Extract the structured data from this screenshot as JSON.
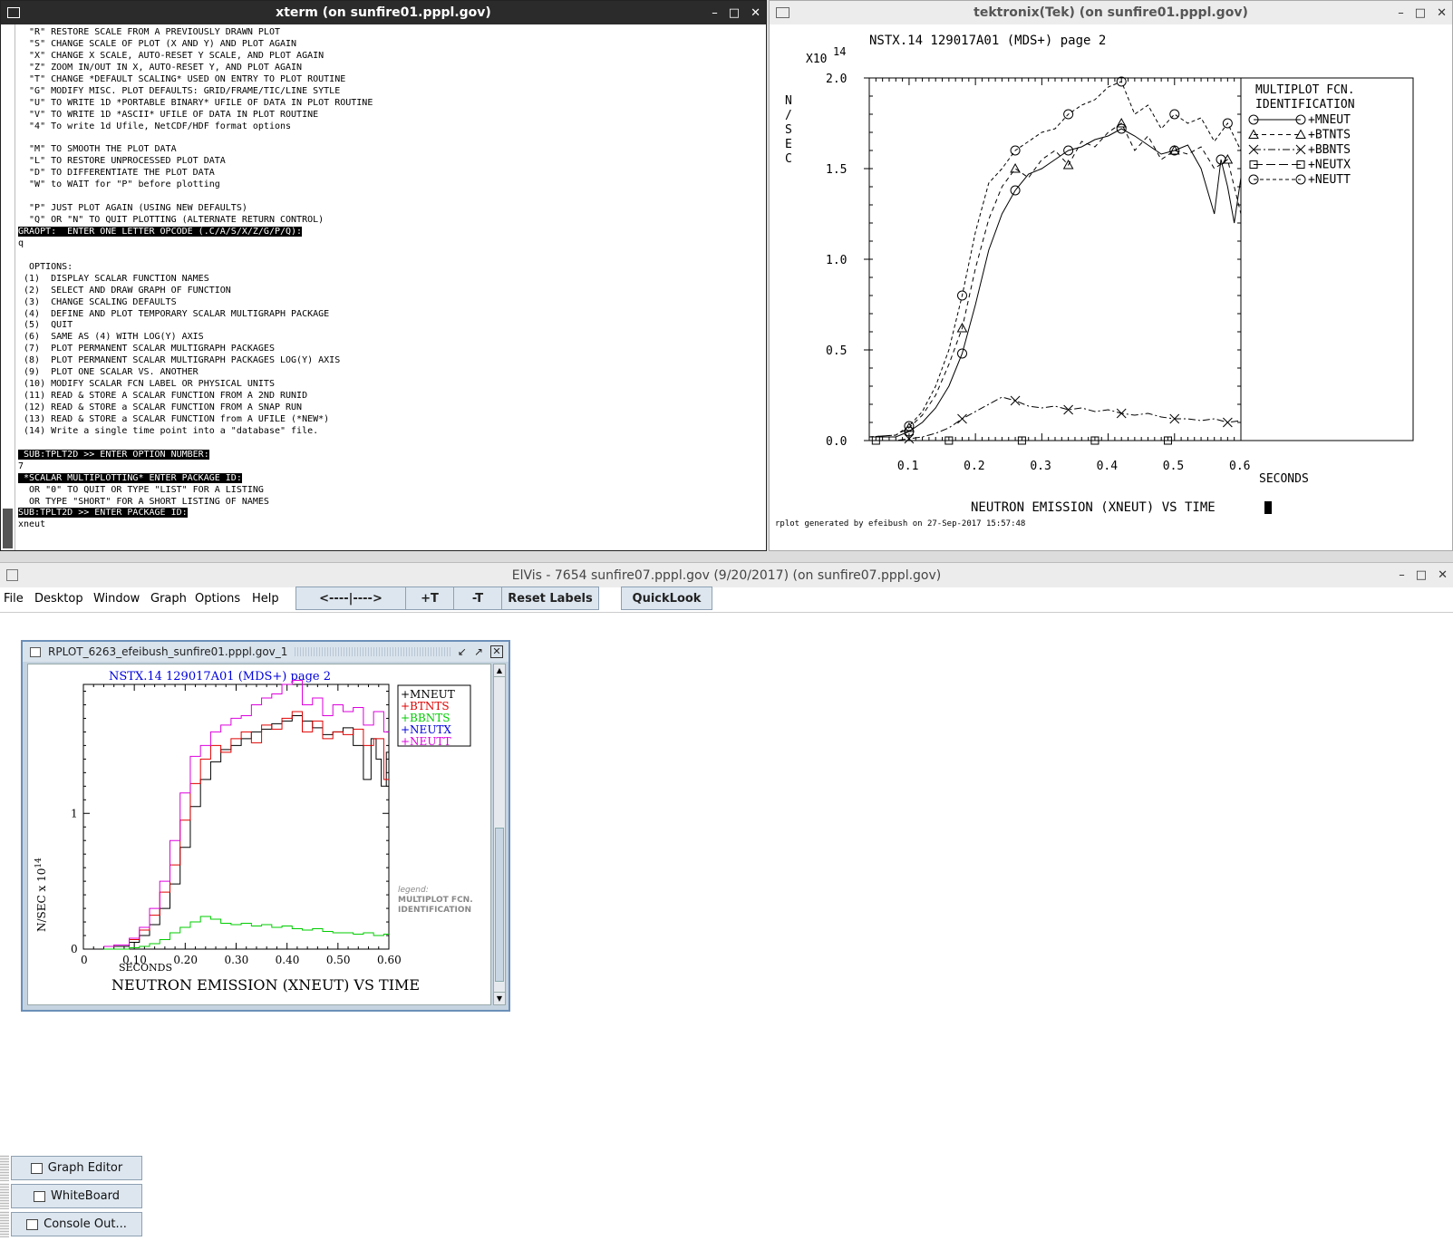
{
  "xterm": {
    "title": "xterm (on sunfire01.pppl.gov)",
    "controls": [
      "–",
      "□",
      "✕"
    ],
    "lines": [
      "  \"R\" RESTORE SCALE FROM A PREVIOUSLY DRAWN PLOT",
      "  \"S\" CHANGE SCALE OF PLOT (X AND Y) AND PLOT AGAIN",
      "  \"X\" CHANGE X SCALE, AUTO-RESET Y SCALE, AND PLOT AGAIN",
      "  \"Z\" ZOOM IN/OUT IN X, AUTO-RESET Y, AND PLOT AGAIN",
      "  \"T\" CHANGE *DEFAULT SCALING* USED ON ENTRY TO PLOT ROUTINE",
      "  \"G\" MODIFY MISC. PLOT DEFAULTS: GRID/FRAME/TIC/LINE SYTLE",
      "  \"U\" TO WRITE 1D *PORTABLE BINARY* UFILE OF DATA IN PLOT ROUTINE",
      "  \"V\" TO WRITE 1D *ASCII* UFILE OF DATA IN PLOT ROUTINE",
      "  \"4\" To write 1d Ufile, NetCDF/HDF format options",
      "",
      "  \"M\" TO SMOOTH THE PLOT DATA",
      "  \"L\" TO RESTORE UNPROCESSED PLOT DATA",
      "  \"D\" TO DIFFERENTIATE THE PLOT DATA",
      "  \"W\" to WAIT for \"P\" before plotting",
      "",
      "  \"P\" JUST PLOT AGAIN (USING NEW DEFAULTS)",
      "  \"Q\" OR \"N\" TO QUIT PLOTTING (ALTERNATE RETURN CONTROL)",
      "GRAOPT:  ENTER ONE LETTER OPCODE (.C/A/S/X/Z/G/P/Q):",
      "q",
      "",
      "  OPTIONS:",
      " (1)  DISPLAY SCALAR FUNCTION NAMES",
      " (2)  SELECT AND DRAW GRAPH OF FUNCTION",
      " (3)  CHANGE SCALING DEFAULTS",
      " (4)  DEFINE AND PLOT TEMPORARY SCALAR MULTIGRAPH PACKAGE",
      " (5)  QUIT",
      " (6)  SAME AS (4) WITH LOG(Y) AXIS",
      " (7)  PLOT PERMANENT SCALAR MULTIGRAPH PACKAGES",
      " (8)  PLOT PERMANENT SCALAR MULTIGRAPH PACKAGES LOG(Y) AXIS",
      " (9)  PLOT ONE SCALAR VS. ANOTHER",
      " (10) MODIFY SCALAR FCN LABEL OR PHYSICAL UNITS",
      " (11) READ & STORE A SCALAR FUNCTION FROM A 2ND RUNID",
      " (12) READ & STORE a SCALAR FUNCTION FROM A SNAP RUN",
      " (13) READ & STORE a SCALAR FUNCTION from A UFILE (*NEW*)",
      " (14) Write a single time point into a \"database\" file.",
      "",
      " SUB:TPLT2D >> ENTER OPTION NUMBER:",
      "7",
      " *SCALAR MULTIPLOTTING* ENTER PACKAGE ID:",
      "  OR \"0\" TO QUIT OR TYPE \"LIST\" FOR A LISTING",
      "  OR TYPE \"SHORT\" FOR A SHORT LISTING OF NAMES",
      "SUB:TPLT2D >> ENTER PACKAGE ID:",
      "xneut"
    ]
  },
  "tek": {
    "title": "tektronix(Tek) (on sunfire01.pppl.gov)",
    "controls": [
      "–",
      "□",
      "✕"
    ],
    "plot_title": "NSTX.14 129017A01 (MDS+) page 2",
    "y_exp_base": "X10",
    "y_exp_pow": "14",
    "y_units_letters": [
      "N",
      "/",
      "S",
      "E",
      "C"
    ],
    "y_ticks": [
      "0.0",
      "0.5",
      "1.0",
      "1.5",
      "2.0"
    ],
    "x_ticks": [
      "0.1",
      "0.2",
      "0.3",
      "0.4",
      "0.5",
      "0.6"
    ],
    "x_label": "SECONDS",
    "bottom_title": "NEUTRON EMISSION (XNEUT) VS TIME",
    "legend_title1": "MULTIPLOT FCN.",
    "legend_title2": "IDENTIFICATION",
    "legend": [
      "+MNEUT",
      "+BTNTS",
      "+BBNTS",
      "+NEUTX",
      "+NEUTT"
    ],
    "footer": "rplot generated by efeibush on 27-Sep-2017 15:57:48"
  },
  "elvis": {
    "title": "ElVis - 7654 sunfire07.pppl.gov   (9/20/2017) (on sunfire07.pppl.gov)",
    "controls": [
      "–",
      "□",
      "✕"
    ],
    "menus": [
      "File",
      "Desktop",
      "Window",
      "Graph",
      "Options",
      "Help"
    ],
    "buttons": {
      "nav": "<----|---->",
      "plus_t": "+T",
      "minus_t": "-T",
      "reset": "Reset Labels",
      "quicklook": "QuickLook"
    },
    "frame_title": "RPLOT_6263_efeibush_sunfire01.pppl.gov_1",
    "side_buttons": {
      "graph_editor": "Graph Editor",
      "whiteboard": "WhiteBoard",
      "console": "Console Out..."
    }
  },
  "chart_data": {
    "type": "line",
    "title": "NSTX.14 129017A01 (MDS+) page 2",
    "xlabel": "SECONDS",
    "ylabel": "N/SEC x 10",
    "ylabel_sup": "14",
    "subtitle": "NEUTRON EMISSION (XNEUT) VS TIME",
    "xlim": [
      0,
      0.6
    ],
    "ylim": [
      0,
      1.95
    ],
    "x_ticks": [
      "0",
      "0.10",
      "0.20",
      "0.30",
      "0.40",
      "0.50",
      "0.60"
    ],
    "y_ticks": [
      "0",
      "1"
    ],
    "legend_caption": "legend:",
    "legend_note1": "MULTIPLOT FCN.",
    "legend_note2": "IDENTIFICATION",
    "colors": {
      "MNEUT": "#000000",
      "BTNTS": "#e00000",
      "BBNTS": "#00cc00",
      "NEUTX": "#0000dd",
      "NEUTT": "#dd00dd"
    },
    "series": [
      {
        "name": "+MNEUT",
        "x": [
          0.04,
          0.08,
          0.1,
          0.12,
          0.14,
          0.16,
          0.18,
          0.2,
          0.22,
          0.24,
          0.26,
          0.28,
          0.3,
          0.32,
          0.34,
          0.36,
          0.38,
          0.4,
          0.42,
          0.44,
          0.46,
          0.48,
          0.5,
          0.52,
          0.54,
          0.56,
          0.57,
          0.58,
          0.59,
          0.6
        ],
        "values": [
          0.02,
          0.02,
          0.05,
          0.1,
          0.18,
          0.3,
          0.48,
          0.75,
          1.05,
          1.25,
          1.38,
          1.47,
          1.5,
          1.55,
          1.6,
          1.62,
          1.66,
          1.68,
          1.72,
          1.68,
          1.63,
          1.58,
          1.6,
          1.63,
          1.5,
          1.25,
          1.55,
          1.4,
          1.2,
          1.45
        ]
      },
      {
        "name": "+BTNTS",
        "x": [
          0.04,
          0.08,
          0.1,
          0.12,
          0.14,
          0.16,
          0.18,
          0.2,
          0.22,
          0.24,
          0.26,
          0.28,
          0.3,
          0.32,
          0.34,
          0.36,
          0.38,
          0.4,
          0.42,
          0.44,
          0.46,
          0.48,
          0.5,
          0.52,
          0.54,
          0.56,
          0.58,
          0.6
        ],
        "values": [
          0.02,
          0.03,
          0.07,
          0.14,
          0.25,
          0.42,
          0.62,
          0.95,
          1.22,
          1.4,
          1.5,
          1.45,
          1.55,
          1.6,
          1.52,
          1.65,
          1.62,
          1.7,
          1.75,
          1.6,
          1.68,
          1.55,
          1.6,
          1.58,
          1.62,
          1.5,
          1.55,
          1.25
        ]
      },
      {
        "name": "+BBNTS",
        "x": [
          0.04,
          0.08,
          0.1,
          0.12,
          0.14,
          0.16,
          0.18,
          0.2,
          0.22,
          0.24,
          0.26,
          0.28,
          0.3,
          0.32,
          0.34,
          0.36,
          0.38,
          0.4,
          0.42,
          0.44,
          0.46,
          0.48,
          0.5,
          0.52,
          0.54,
          0.56,
          0.58,
          0.6
        ],
        "values": [
          0,
          0,
          0.01,
          0.02,
          0.04,
          0.07,
          0.12,
          0.16,
          0.2,
          0.24,
          0.22,
          0.19,
          0.18,
          0.19,
          0.17,
          0.18,
          0.16,
          0.17,
          0.15,
          0.14,
          0.15,
          0.13,
          0.12,
          0.12,
          0.11,
          0.12,
          0.1,
          0.11
        ]
      },
      {
        "name": "+NEUTX",
        "x": [],
        "values": []
      },
      {
        "name": "+NEUTT",
        "x": [
          0.04,
          0.08,
          0.1,
          0.12,
          0.14,
          0.16,
          0.18,
          0.2,
          0.22,
          0.24,
          0.26,
          0.28,
          0.3,
          0.32,
          0.34,
          0.36,
          0.38,
          0.4,
          0.42,
          0.44,
          0.46,
          0.48,
          0.5,
          0.52,
          0.54,
          0.56,
          0.58,
          0.6
        ],
        "values": [
          0.02,
          0.03,
          0.08,
          0.16,
          0.3,
          0.5,
          0.8,
          1.15,
          1.42,
          1.5,
          1.6,
          1.65,
          1.7,
          1.72,
          1.8,
          1.85,
          1.88,
          1.95,
          1.98,
          1.8,
          1.85,
          1.72,
          1.8,
          1.75,
          1.78,
          1.65,
          1.75,
          1.6
        ]
      }
    ]
  }
}
